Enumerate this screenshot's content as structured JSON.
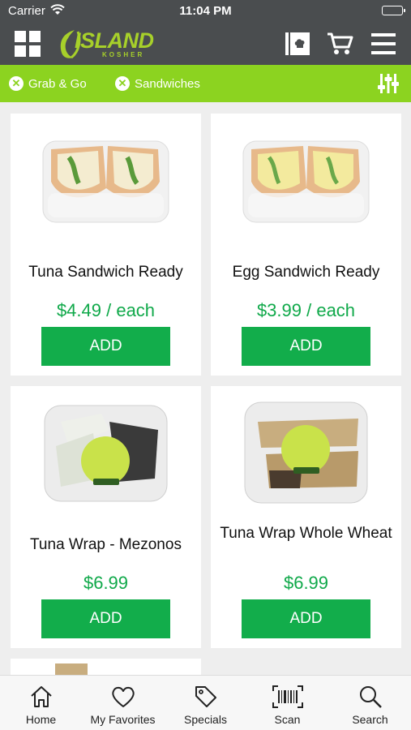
{
  "status_bar": {
    "carrier": "Carrier",
    "time": "11:04 PM"
  },
  "header": {
    "logo_text": "ISLAND",
    "logo_subtext": "KOSHER",
    "left_icon": "grid-icon",
    "right_icons": [
      "recipe-book-icon",
      "cart-icon",
      "hamburger-menu-icon"
    ]
  },
  "filters": {
    "chips": [
      {
        "label": "Grab & Go"
      },
      {
        "label": "Sandwiches"
      }
    ],
    "settings_icon": "sliders-icon"
  },
  "products": [
    {
      "name": "Tuna Sandwich Ready",
      "price": "$4.49 / each",
      "button": "ADD",
      "image": "sandwich-photo"
    },
    {
      "name": "Egg Sandwich Ready",
      "price": "$3.99 / each",
      "button": "ADD",
      "image": "sandwich-photo"
    },
    {
      "name": "Tuna Wrap - Mezonos",
      "price": "$6.99",
      "button": "ADD",
      "image": "wrap-container-photo"
    },
    {
      "name": "Tuna Wrap Whole Wheat",
      "price": "$6.99",
      "button": "ADD",
      "image": "wrap-container-photo"
    }
  ],
  "tabbar": {
    "tabs": [
      {
        "label": "Home",
        "icon": "home-icon"
      },
      {
        "label": "My Favorites",
        "icon": "heart-icon"
      },
      {
        "label": "Specials",
        "icon": "tag-icon"
      },
      {
        "label": "Scan",
        "icon": "barcode-icon"
      },
      {
        "label": "Search",
        "icon": "search-icon"
      }
    ]
  },
  "colors": {
    "header_bg": "#4a4d4f",
    "accent_green": "#8cd320",
    "button_green": "#12ad4b",
    "price_green": "#10a94a"
  }
}
